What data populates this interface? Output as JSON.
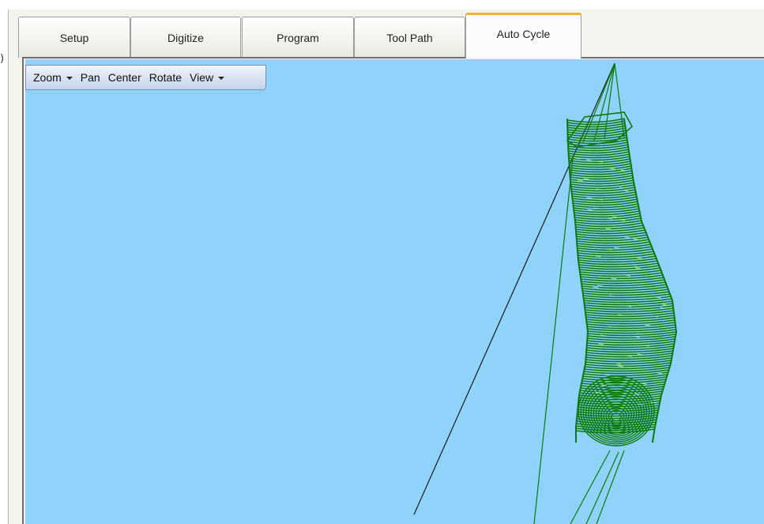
{
  "tabs": [
    {
      "label": "Setup",
      "active": false
    },
    {
      "label": "Digitize",
      "active": false
    },
    {
      "label": "Program",
      "active": false
    },
    {
      "label": "Tool Path",
      "active": false
    },
    {
      "label": "Auto Cycle",
      "active": true
    }
  ],
  "toolbar": {
    "zoom_label": "Zoom",
    "pan_label": "Pan",
    "center_label": "Center",
    "rotate_label": "Rotate",
    "view_label": "View"
  },
  "left_edge_glyph": ")",
  "colors": {
    "viewport_background": "#8fd3fa",
    "toolpath_green": "#0b7a0b",
    "active_tab_accent": "#f4b22e",
    "rapid_line": "#1a1a1a"
  },
  "icons": {
    "dropdown": "chevron-down-icon"
  }
}
